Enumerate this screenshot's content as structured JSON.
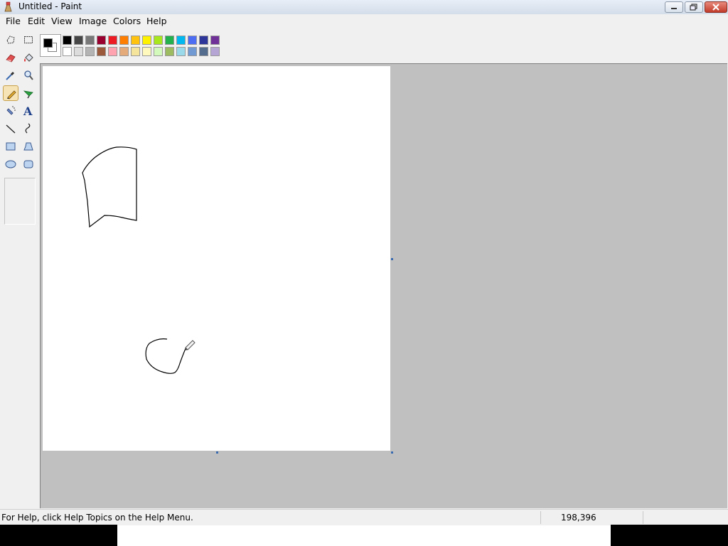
{
  "window": {
    "title": "Untitled - Paint",
    "icon": "paint-icon",
    "controls": [
      "minimize-icon",
      "restore-icon",
      "close-icon"
    ]
  },
  "menu": [
    "File",
    "Edit",
    "View",
    "Image",
    "Colors",
    "Help"
  ],
  "tools": [
    {
      "name": "free-form-select",
      "icon": "free-select-icon"
    },
    {
      "name": "select",
      "icon": "rect-select-icon"
    },
    {
      "name": "eraser",
      "icon": "eraser-icon"
    },
    {
      "name": "fill-with-color",
      "icon": "bucket-icon"
    },
    {
      "name": "pick-color",
      "icon": "eyedropper-icon"
    },
    {
      "name": "magnifier",
      "icon": "magnifier-icon"
    },
    {
      "name": "pencil",
      "icon": "pencil-icon",
      "selected": true
    },
    {
      "name": "brush",
      "icon": "brush-icon"
    },
    {
      "name": "airbrush",
      "icon": "airbrush-icon"
    },
    {
      "name": "text",
      "icon": "text-icon",
      "glyph": "A"
    },
    {
      "name": "line",
      "icon": "line-icon"
    },
    {
      "name": "curve",
      "icon": "curve-icon"
    },
    {
      "name": "rectangle",
      "icon": "rectangle-icon"
    },
    {
      "name": "polygon",
      "icon": "polygon-icon"
    },
    {
      "name": "ellipse",
      "icon": "ellipse-icon"
    },
    {
      "name": "rounded-rectangle",
      "icon": "rounded-rect-icon"
    }
  ],
  "colors": {
    "foreground": "#000000",
    "background": "#ffffff",
    "palette_row1": [
      "#000000",
      "#464646",
      "#787878",
      "#990030",
      "#ed1c24",
      "#ff7e00",
      "#ffc20e",
      "#fff200",
      "#a8e61d",
      "#22b14c",
      "#00b7ef",
      "#4d6df3",
      "#2f3699",
      "#6f3198"
    ],
    "palette_row2": [
      "#ffffff",
      "#dcdcdc",
      "#b4b4b4",
      "#9c5a3c",
      "#ffa3b1",
      "#e5aa7a",
      "#f5e49c",
      "#fff9bd",
      "#d3f9bc",
      "#9dbb61",
      "#99d9ea",
      "#709ad1",
      "#546d8e",
      "#b5a5d5"
    ]
  },
  "status": {
    "help": "For Help, click Help Topics on the Help Menu.",
    "coords": "198,396"
  }
}
